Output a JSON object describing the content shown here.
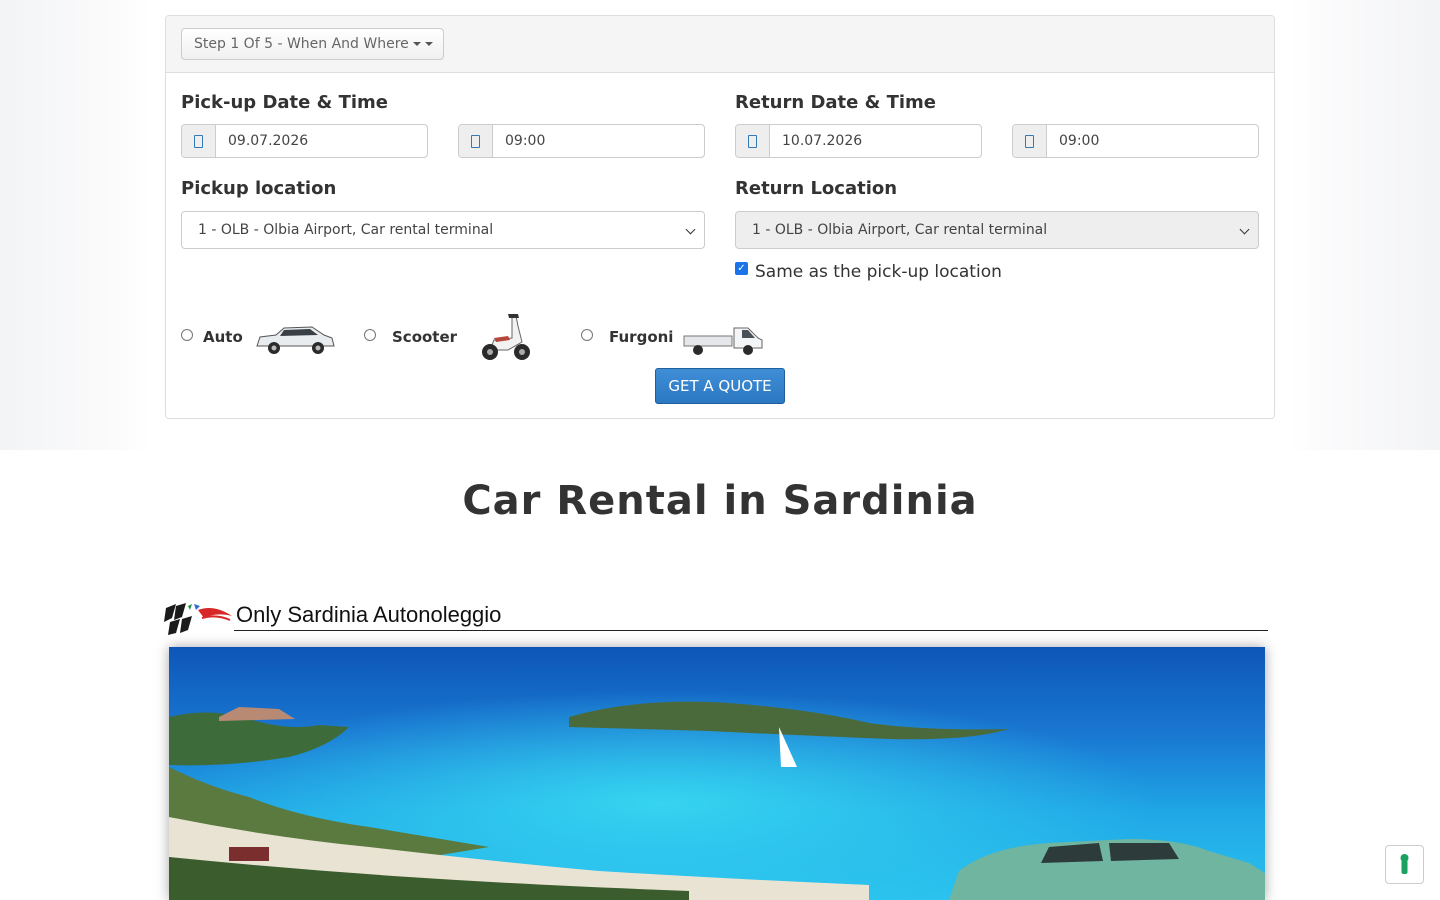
{
  "booking_form": {
    "step_label": "Step 1 Of 5 - When And Where",
    "pickup_datetime_label": "Pick-up Date & Time",
    "return_datetime_label": "Return Date & Time",
    "pickup_date": "09.07.2026",
    "pickup_time": "09:00",
    "return_date": "10.07.2026",
    "return_time": "09:00",
    "pickup_location_label": "Pickup location",
    "return_location_label": "Return Location",
    "pickup_location_value": "1 - OLB - Olbia Airport, Car rental terminal",
    "return_location_value": "1 - OLB - Olbia Airport, Car rental terminal",
    "same_location_checked": true,
    "same_location_label": "Same as the pick-up location",
    "vehicle_types": [
      {
        "label": "Auto",
        "selected": false,
        "icon": "car-icon"
      },
      {
        "label": "Scooter",
        "selected": false,
        "icon": "scooter-icon"
      },
      {
        "label": "Furgoni",
        "selected": false,
        "icon": "van-icon"
      }
    ],
    "submit_label": "GET A QUOTE"
  },
  "page": {
    "heading": "Car Rental in Sardinia",
    "brand_name": "Only Sardinia Autonoleggio",
    "hero_image": "sardinia-beach-with-car"
  },
  "colors": {
    "primary_button": "#2f80cc",
    "checkbox": "#1a73e8",
    "addon_icon": "#337ab7",
    "scroll_icon": "#1aa260"
  },
  "icons": {
    "calendar": "calendar-icon",
    "clock": "clock-icon",
    "scroll_up": "arrow-up-icon"
  }
}
